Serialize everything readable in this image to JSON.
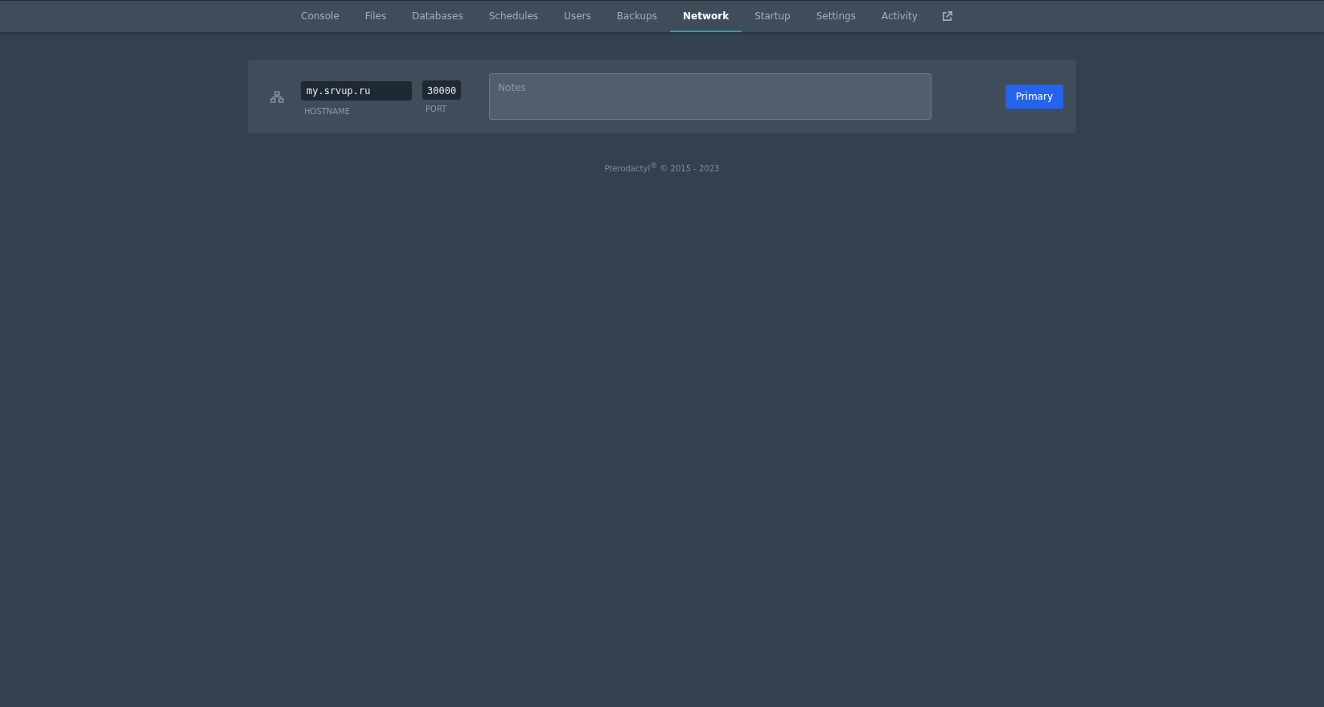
{
  "tabs": [
    {
      "label": "Console",
      "selected": false
    },
    {
      "label": "Files",
      "selected": false
    },
    {
      "label": "Databases",
      "selected": false
    },
    {
      "label": "Schedules",
      "selected": false
    },
    {
      "label": "Users",
      "selected": false
    },
    {
      "label": "Backups",
      "selected": false
    },
    {
      "label": "Network",
      "selected": true
    },
    {
      "label": "Startup",
      "selected": false
    },
    {
      "label": "Settings",
      "selected": false
    },
    {
      "label": "Activity",
      "selected": false
    }
  ],
  "allocations": [
    {
      "hostname": "my.srvup.ru",
      "hostname_label": "HOSTNAME",
      "port": "30000",
      "port_label": "PORT",
      "notes_placeholder": "Notes",
      "badge": "Primary"
    }
  ],
  "footer": "Pterodactyl$^{®}$ © 2015 - 2023"
}
